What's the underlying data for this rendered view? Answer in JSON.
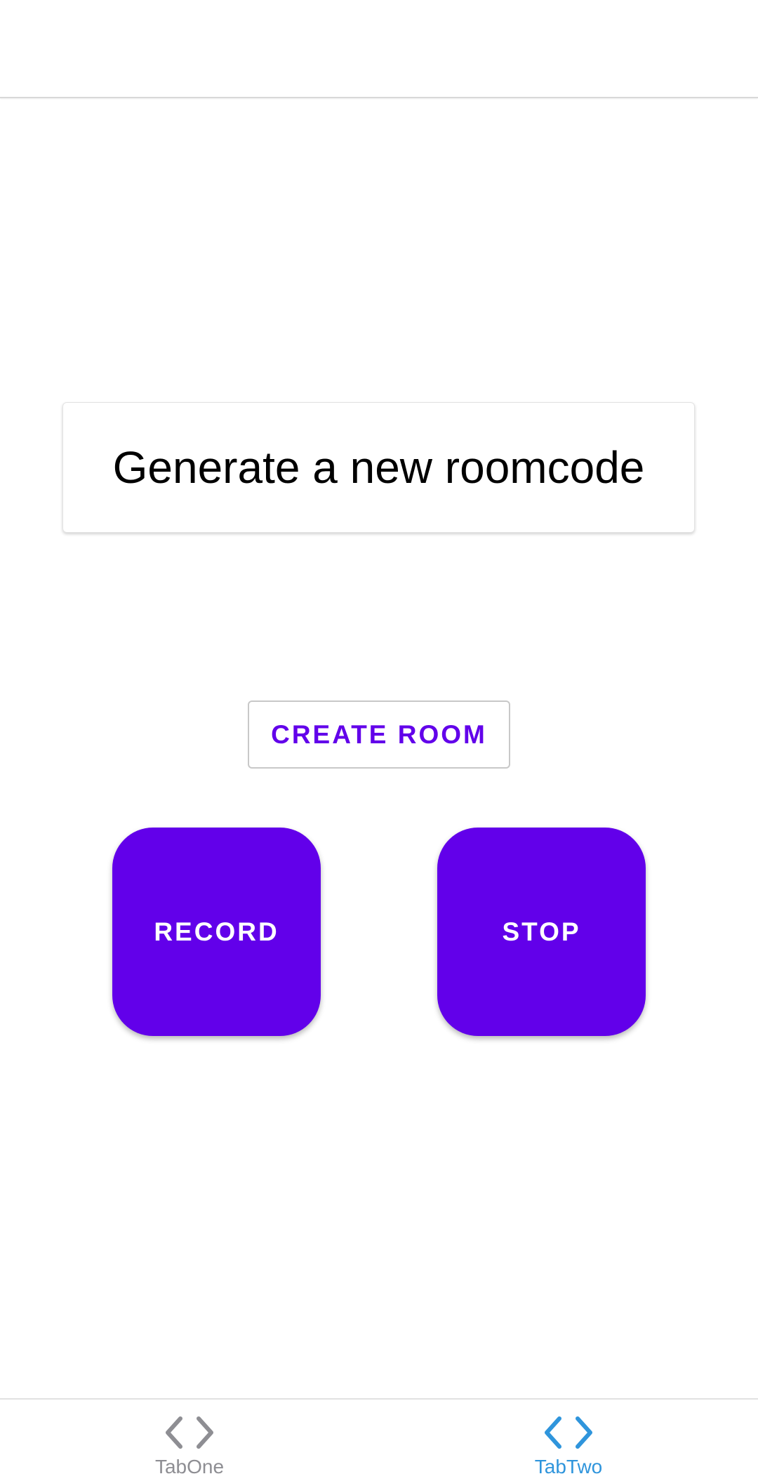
{
  "main": {
    "roomcode_text": "Generate a new roomcode",
    "create_room_label": "CREATE ROOM",
    "record_label": "RECORD",
    "stop_label": "STOP"
  },
  "tabbar": {
    "tabs": [
      {
        "label": "TabOne",
        "icon": "code-icon",
        "active": false
      },
      {
        "label": "TabTwo",
        "icon": "code-icon",
        "active": true
      }
    ]
  },
  "colors": {
    "accent": "#6200ea",
    "tab_active": "#2f95dc",
    "tab_inactive": "#8e8e93"
  }
}
